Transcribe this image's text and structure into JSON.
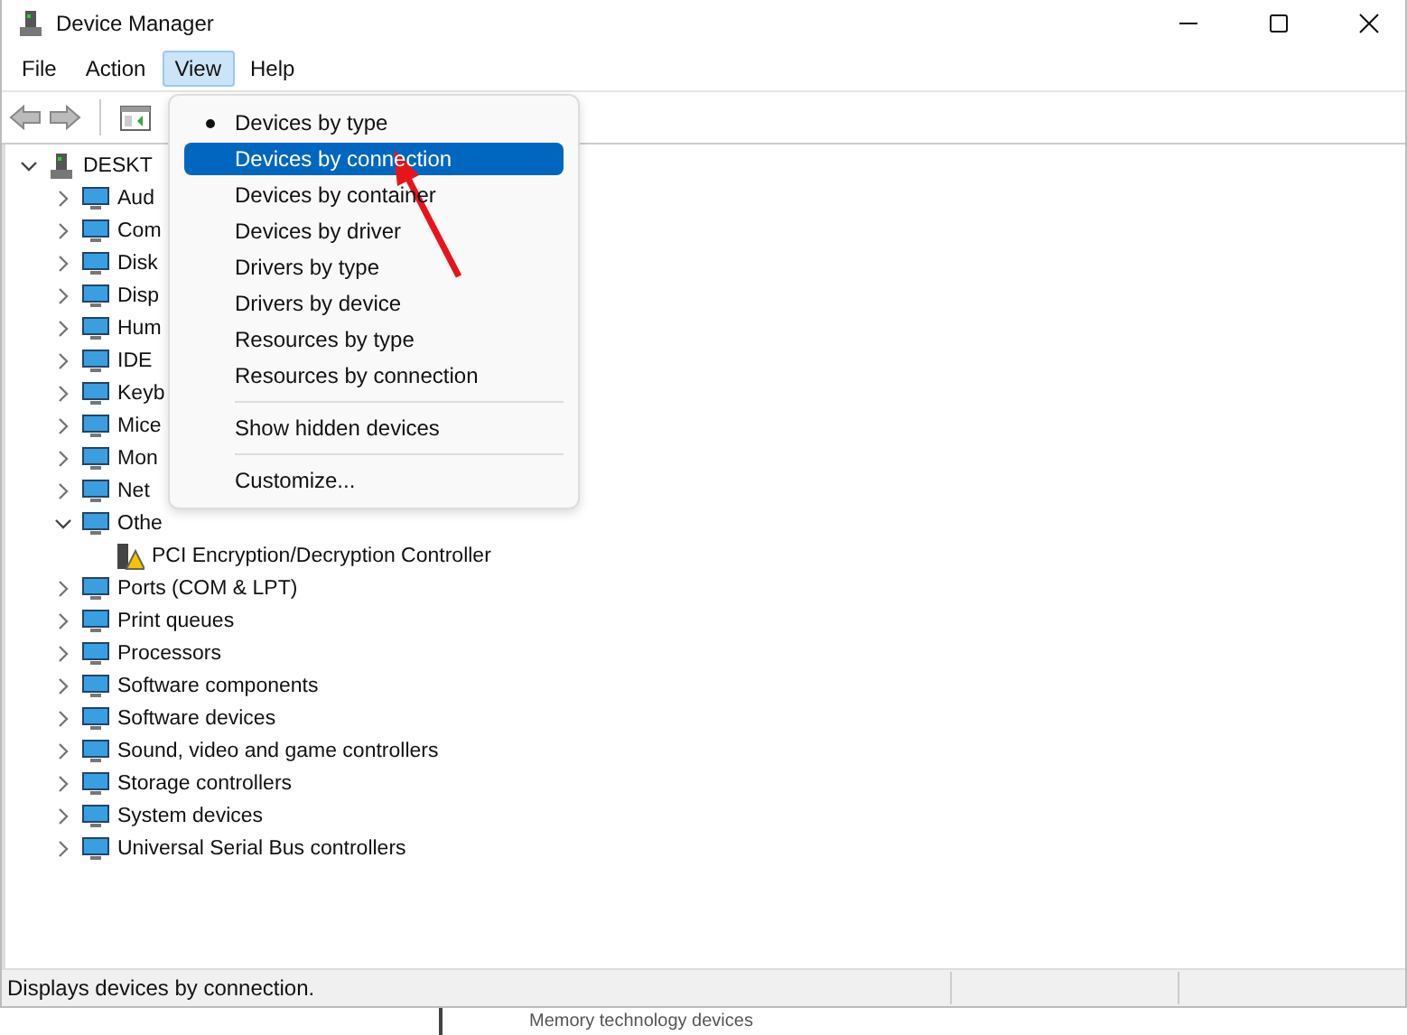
{
  "window": {
    "title": "Device Manager"
  },
  "menu_bar": [
    {
      "label": "File",
      "selected": false
    },
    {
      "label": "Action",
      "selected": false
    },
    {
      "label": "View",
      "selected": true
    },
    {
      "label": "Help",
      "selected": false
    }
  ],
  "view_menu": {
    "items": [
      {
        "kind": "option",
        "label": "Devices by type",
        "checked": true,
        "selected": false
      },
      {
        "kind": "option",
        "label": "Devices by connection",
        "checked": false,
        "selected": true
      },
      {
        "kind": "option",
        "label": "Devices by container",
        "checked": false,
        "selected": false
      },
      {
        "kind": "option",
        "label": "Devices by driver",
        "checked": false,
        "selected": false
      },
      {
        "kind": "option",
        "label": "Drivers by type",
        "checked": false,
        "selected": false
      },
      {
        "kind": "option",
        "label": "Drivers by device",
        "checked": false,
        "selected": false
      },
      {
        "kind": "option",
        "label": "Resources by type",
        "checked": false,
        "selected": false
      },
      {
        "kind": "option",
        "label": "Resources by connection",
        "checked": false,
        "selected": false
      },
      {
        "kind": "separator"
      },
      {
        "kind": "option",
        "label": "Show hidden devices",
        "checked": false,
        "selected": false
      },
      {
        "kind": "separator"
      },
      {
        "kind": "option",
        "label": "Customize...",
        "checked": false,
        "selected": false
      }
    ]
  },
  "tree": {
    "label": "DESKT",
    "expanded": true,
    "children": [
      {
        "label": "Aud",
        "expanded": false
      },
      {
        "label": "Com",
        "expanded": false
      },
      {
        "label": "Disk",
        "expanded": false
      },
      {
        "label": "Disp",
        "expanded": false
      },
      {
        "label": "Hum",
        "expanded": false
      },
      {
        "label": "IDE",
        "expanded": false
      },
      {
        "label": "Keyb",
        "expanded": false
      },
      {
        "label": "Mice",
        "expanded": false
      },
      {
        "label": "Mon",
        "expanded": false
      },
      {
        "label": "Net",
        "expanded": false
      },
      {
        "label": "Othe",
        "expanded": true,
        "children": [
          {
            "label": "PCI Encryption/Decryption Controller",
            "warning": true
          }
        ]
      },
      {
        "label": "Ports (COM & LPT)",
        "expanded": false
      },
      {
        "label": "Print queues",
        "expanded": false
      },
      {
        "label": "Processors",
        "expanded": false
      },
      {
        "label": "Software components",
        "expanded": false
      },
      {
        "label": "Software devices",
        "expanded": false
      },
      {
        "label": "Sound, video and game controllers",
        "expanded": false
      },
      {
        "label": "Storage controllers",
        "expanded": false
      },
      {
        "label": "System devices",
        "expanded": false
      },
      {
        "label": "Universal Serial Bus controllers",
        "expanded": false
      }
    ]
  },
  "status_bar": {
    "text": "Displays devices by connection."
  },
  "background_window": {
    "text": "Memory technology devices"
  }
}
